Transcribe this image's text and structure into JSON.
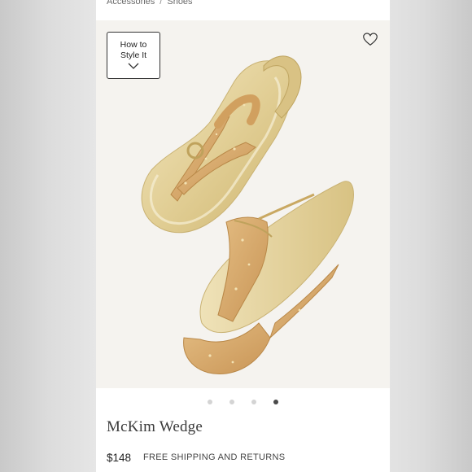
{
  "breadcrumb": {
    "items": [
      "Accessories",
      "Shoes"
    ],
    "separator": "/"
  },
  "style_button": {
    "label": "How to Style It",
    "icon": "chevron-down-icon"
  },
  "favorite": {
    "icon": "heart-outline-icon"
  },
  "carousel": {
    "total": 4,
    "active_index": 3
  },
  "product": {
    "name": "McKim Wedge",
    "price": "$148",
    "shipping_note": "FREE SHIPPING AND RETURNS"
  },
  "colors": {
    "gold": "#e2cf96",
    "cork": "#d7ab6d",
    "text": "#3a3a3a"
  }
}
